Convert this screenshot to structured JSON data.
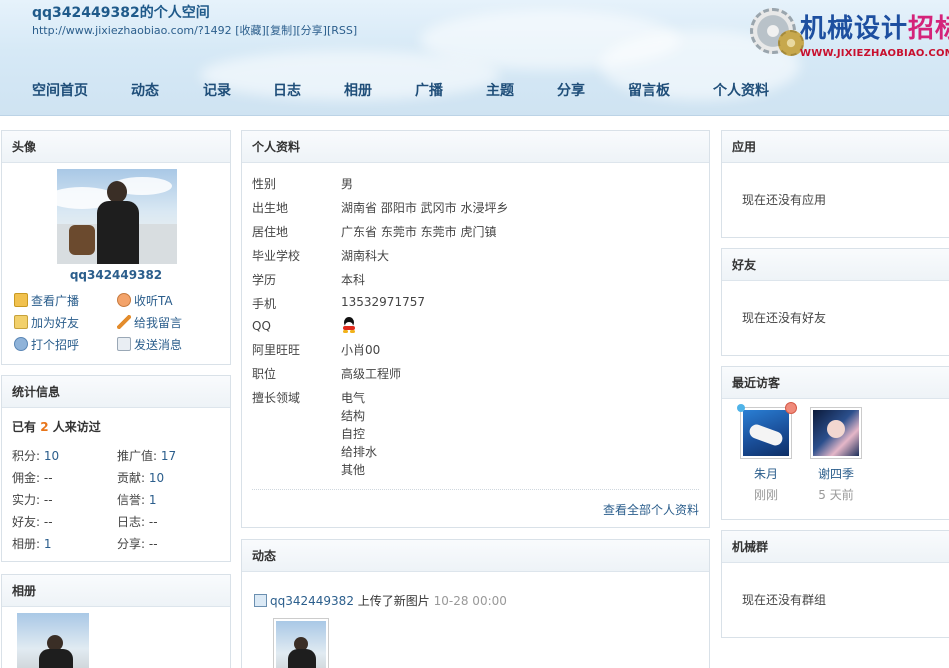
{
  "header": {
    "title": "qq342449382的个人空间",
    "url": "http://www.jixiezhaobiao.com/?1492",
    "links": [
      "[收藏]",
      "[复制]",
      "[分享]",
      "[RSS]"
    ],
    "logo": {
      "text_main": "机械设计",
      "text_accent": "招标网",
      "url_text": "WWW.JIXIEZHAOBIAO.COM"
    }
  },
  "nav": [
    "空间首页",
    "动态",
    "记录",
    "日志",
    "相册",
    "广播",
    "主题",
    "分享",
    "留言板",
    "个人资料"
  ],
  "avatar_panel": {
    "title": "头像",
    "username": "qq342449382",
    "actions": [
      "查看广播",
      "收听TA",
      "加为好友",
      "给我留言",
      "打个招呼",
      "发送消息"
    ]
  },
  "stats_panel": {
    "title": "统计信息",
    "visit_prefix": "已有",
    "visit_count": "2",
    "visit_suffix": "人来访过",
    "items": [
      {
        "label": "积分:",
        "value": "10"
      },
      {
        "label": "推广值:",
        "value": "17"
      },
      {
        "label": "佣金:",
        "value": "--"
      },
      {
        "label": "贡献:",
        "value": "10"
      },
      {
        "label": "实力:",
        "value": "--"
      },
      {
        "label": "信誉:",
        "value": "1"
      },
      {
        "label": "好友:",
        "value": "--"
      },
      {
        "label": "日志:",
        "value": "--"
      },
      {
        "label": "相册:",
        "value": "1"
      },
      {
        "label": "分享:",
        "value": "--"
      }
    ]
  },
  "album_panel": {
    "title": "相册"
  },
  "profile_panel": {
    "title": "个人资料",
    "rows": [
      {
        "key": "性别",
        "value": "男"
      },
      {
        "key": "出生地",
        "value": "湖南省 邵阳市 武冈市 水浸坪乡"
      },
      {
        "key": "居住地",
        "value": "广东省 东莞市 东莞市 虎门镇"
      },
      {
        "key": "毕业学校",
        "value": "湖南科大"
      },
      {
        "key": "学历",
        "value": "本科"
      },
      {
        "key": "手机",
        "value": "13532971757"
      },
      {
        "key": "QQ",
        "value": ""
      },
      {
        "key": "阿里旺旺",
        "value": "小肖00"
      },
      {
        "key": "职位",
        "value": "高级工程师"
      },
      {
        "key": "擅长领域",
        "value": ""
      }
    ],
    "specialties": [
      "电气",
      "结构",
      "自控",
      "给排水",
      "其他"
    ],
    "view_all": "查看全部个人资料"
  },
  "feed_panel": {
    "title": "动态",
    "item": {
      "user": "qq342449382",
      "action": "上传了新图片",
      "time": "10-28 00:00"
    }
  },
  "apps_panel": {
    "title": "应用",
    "empty": "现在还没有应用"
  },
  "friends_panel": {
    "title": "好友",
    "empty": "现在还没有好友"
  },
  "visitors_panel": {
    "title": "最近访客",
    "visitors": [
      {
        "name": "朱月",
        "time": "刚刚"
      },
      {
        "name": "谢四季",
        "time": "5 天前"
      }
    ]
  },
  "group_panel": {
    "title": "机械群",
    "empty": "现在还没有群组"
  },
  "colors": {
    "link": "#2b5e8c",
    "nav": "#1f4e79",
    "accent_orange": "#e8751a",
    "logo_blue": "#1d4fa0",
    "logo_pink": "#d4237a"
  }
}
